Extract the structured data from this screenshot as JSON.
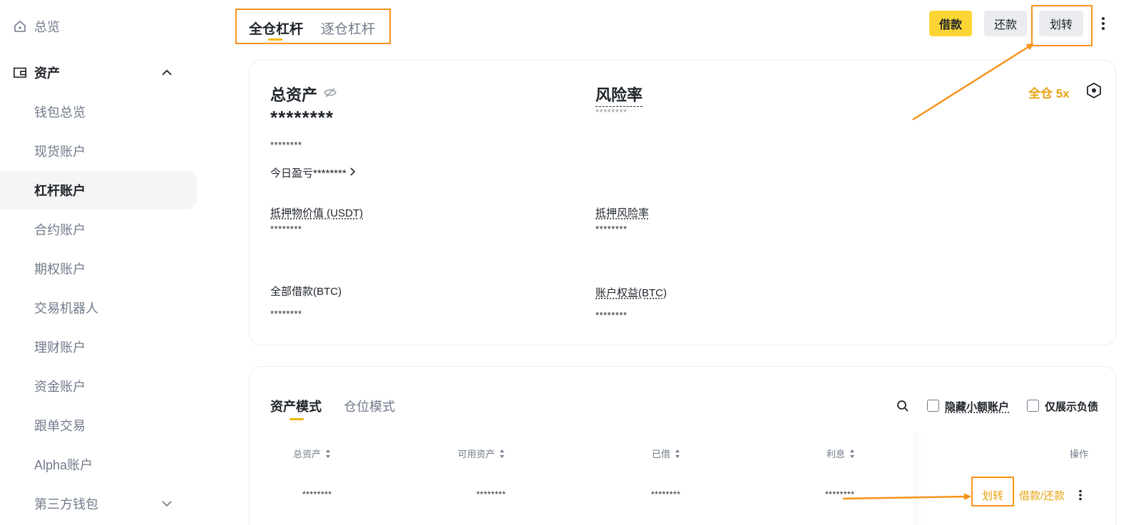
{
  "sidebar": {
    "overview": "总览",
    "assets_section": "资产",
    "items": [
      {
        "label": "钱包总览"
      },
      {
        "label": "现货账户"
      },
      {
        "label": "杠杆账户"
      },
      {
        "label": "合约账户"
      },
      {
        "label": "期权账户"
      },
      {
        "label": "交易机器人"
      },
      {
        "label": "理财账户"
      },
      {
        "label": "资金账户"
      },
      {
        "label": "跟单交易"
      },
      {
        "label": "Alpha账户"
      },
      {
        "label": "第三方钱包"
      }
    ],
    "active_item": "杠杆账户"
  },
  "top_tabs": {
    "cross": "全仓杠杆",
    "isolated": "逐仓杠杆"
  },
  "toolbar": {
    "borrow": "借款",
    "repay": "还款",
    "transfer": "划转"
  },
  "summary": {
    "total_assets_label": "总资产",
    "total_assets_value": "********",
    "total_assets_sub": "********",
    "today_pnl": "今日盈亏********",
    "risk_ratio_label": "风险率",
    "risk_ratio_value": "********",
    "leverage_badge": "全仓 5x",
    "collateral_value_label": "抵押物价值 (USDT)",
    "collateral_value": "********",
    "collateral_risk_label": "抵押风险率",
    "collateral_risk_value": "********",
    "total_borrowed_label": "全部借款(BTC)",
    "total_borrowed_value": "********",
    "account_equity_label": "账户权益(BTC)",
    "account_equity_value": "********"
  },
  "assets_panel": {
    "tabs": [
      "资产模式",
      "仓位模式"
    ],
    "hide_small_label": "隐藏小额账户",
    "show_debt_only_label": "仅展示负债",
    "columns": [
      "总资产",
      "可用资产",
      "已借",
      "利息",
      "操作"
    ],
    "rows": [
      {
        "total": "********",
        "available": "********",
        "borrowed": "********",
        "interest": "********"
      }
    ],
    "row_actions": {
      "transfer": "划转",
      "borrow_repay": "借款/还款"
    }
  },
  "colors": {
    "accent_yellow": "#fcd535",
    "highlight_orange": "#f7931a",
    "link_orange": "#e8a20f"
  }
}
